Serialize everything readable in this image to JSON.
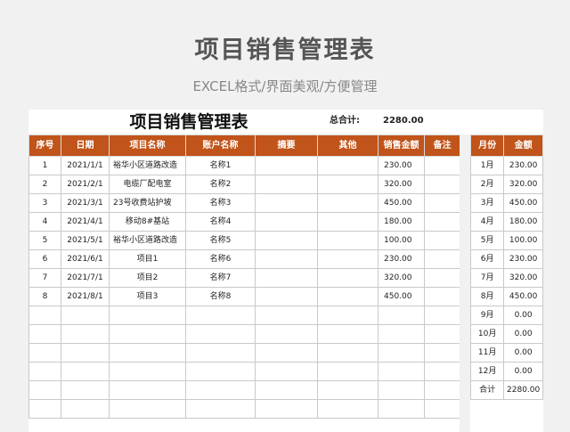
{
  "page": {
    "title": "项目销售管理表",
    "subtitle": "EXCEL格式/界面美观/方便管理"
  },
  "sheet": {
    "title": "项目销售管理表",
    "total_label": "总合计:",
    "total_value": "2280.00"
  },
  "main_table": {
    "headers": [
      "序号",
      "日期",
      "项目名称",
      "账户名称",
      "摘要",
      "其他",
      "销售金额",
      "备注"
    ],
    "rows": [
      [
        "1",
        "2021/1/1",
        "裕华小区道路改造",
        "名称1",
        "",
        "",
        "230.00",
        ""
      ],
      [
        "2",
        "2021/2/1",
        "电缆厂配电室",
        "名称2",
        "",
        "",
        "320.00",
        ""
      ],
      [
        "3",
        "2021/3/1",
        "23号收费站护坡",
        "名称3",
        "",
        "",
        "450.00",
        ""
      ],
      [
        "4",
        "2021/4/1",
        "移动8#基站",
        "名称4",
        "",
        "",
        "180.00",
        ""
      ],
      [
        "5",
        "2021/5/1",
        "裕华小区道路改造",
        "名称5",
        "",
        "",
        "100.00",
        ""
      ],
      [
        "6",
        "2021/6/1",
        "项目1",
        "名称6",
        "",
        "",
        "230.00",
        ""
      ],
      [
        "7",
        "2021/7/1",
        "项目2",
        "名称7",
        "",
        "",
        "320.00",
        ""
      ],
      [
        "8",
        "2021/8/1",
        "项目3",
        "名称8",
        "",
        "",
        "450.00",
        ""
      ],
      [
        "",
        "",
        "",
        "",
        "",
        "",
        "",
        ""
      ],
      [
        "",
        "",
        "",
        "",
        "",
        "",
        "",
        ""
      ],
      [
        "",
        "",
        "",
        "",
        "",
        "",
        "",
        ""
      ],
      [
        "",
        "",
        "",
        "",
        "",
        "",
        "",
        ""
      ],
      [
        "",
        "",
        "",
        "",
        "",
        "",
        "",
        ""
      ],
      [
        "",
        "",
        "",
        "",
        "",
        "",
        "",
        ""
      ]
    ]
  },
  "monthly_table": {
    "headers": [
      "月份",
      "金额"
    ],
    "rows": [
      [
        "1月",
        "230.00"
      ],
      [
        "2月",
        "320.00"
      ],
      [
        "3月",
        "450.00"
      ],
      [
        "4月",
        "180.00"
      ],
      [
        "5月",
        "100.00"
      ],
      [
        "6月",
        "230.00"
      ],
      [
        "7月",
        "320.00"
      ],
      [
        "8月",
        "450.00"
      ],
      [
        "9月",
        "0.00"
      ],
      [
        "10月",
        "0.00"
      ],
      [
        "11月",
        "0.00"
      ],
      [
        "12月",
        "0.00"
      ],
      [
        "合计",
        "2280.00"
      ]
    ]
  },
  "colors": {
    "header_fill": "#c0541a",
    "page_background": "#f1f1f1"
  }
}
